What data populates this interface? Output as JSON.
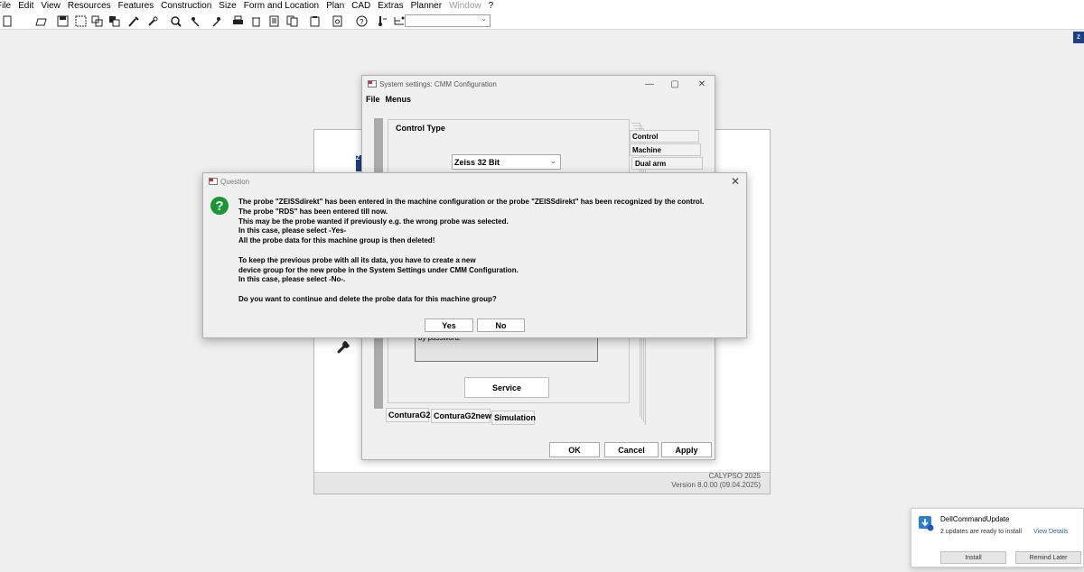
{
  "menubar": {
    "items": [
      "File",
      "Edit",
      "View",
      "Resources",
      "Features",
      "Construction",
      "Size",
      "Form and Location",
      "Plan",
      "CAD",
      "Extras",
      "Planner",
      "Window",
      "?"
    ],
    "disabled": [
      "Window"
    ]
  },
  "toolbar": {
    "icons": [
      "new-icon",
      "open-icon",
      "save-icon",
      "select-icon",
      "copy-icon",
      "paste-icon",
      "brush-icon",
      "tool-icon",
      "search-icon",
      "probe-icon",
      "probe-alt-icon",
      "print-icon",
      "delete-icon",
      "list-icon",
      "copy-list-icon",
      "clipboard-icon",
      "report-icon",
      "help-icon",
      "temperature-icon",
      "tree-icon"
    ],
    "combo_value": ""
  },
  "main_panel": {
    "version_line1": "CALYPSO 2025",
    "version_line2": "Version 8.0.00 (09.04.2025)",
    "blue_tile_text": "Z"
  },
  "cmm_window": {
    "title": "System settings: CMM Configuration",
    "menus": [
      "File",
      "Menus"
    ],
    "control_type_label": "Control Type",
    "control_type_value": "Zeiss 32 Bit",
    "side_tabs": [
      "Control",
      "Machine",
      "Dual arm"
    ],
    "password_text": "by password.",
    "service_label": "Service",
    "bottom_tabs": [
      "ConturaG2",
      "ConturaG2new",
      "Simulation"
    ],
    "ok_label": "OK",
    "cancel_label": "Cancel",
    "apply_label": "Apply"
  },
  "question_dialog": {
    "title": "Question",
    "lines": [
      "The probe \"ZEISSdirekt\" has been entered in the machine configuration or the probe \"ZEISSdirekt\" has been recognized by the control.",
      "The probe \"RDS\" has been entered till now.",
      "This may be the probe wanted if previously e.g. the wrong probe was selected.",
      "In this case, please select -Yes-",
      "All the probe data for this machine group is then deleted!",
      "",
      "To keep the previous probe with all its data, you have to create a new",
      "device group for the new probe in the System Settings under CMM Configuration.",
      "In this case, please select -No-.",
      "",
      "Do you want to continue and delete the probe data for this machine group?"
    ],
    "yes_label": "Yes",
    "no_label": "No"
  },
  "notification": {
    "title": "DellCommandUpdate",
    "message": "2 updates are ready to install",
    "link": "View Details",
    "install_label": "Install",
    "remind_label": "Remind Later"
  }
}
